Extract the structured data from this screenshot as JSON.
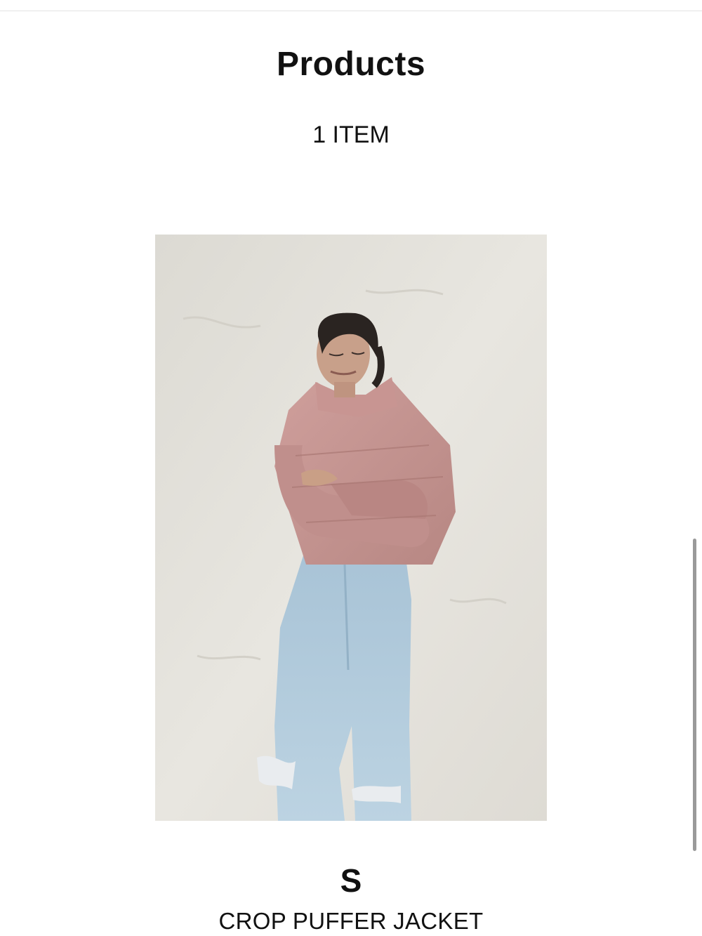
{
  "header": {
    "title": "Products",
    "item_count": "1 ITEM"
  },
  "product": {
    "image_alt": "Model wearing a pink crop puffer jacket and light blue ripped jeans",
    "size": "S",
    "name": "CROP PUFFER JACKET"
  },
  "colors": {
    "background": "#ffffff",
    "text": "#111111",
    "jacket": "#c99595",
    "jeans": "#a9c8df",
    "backdrop": "#e5e3dd"
  }
}
